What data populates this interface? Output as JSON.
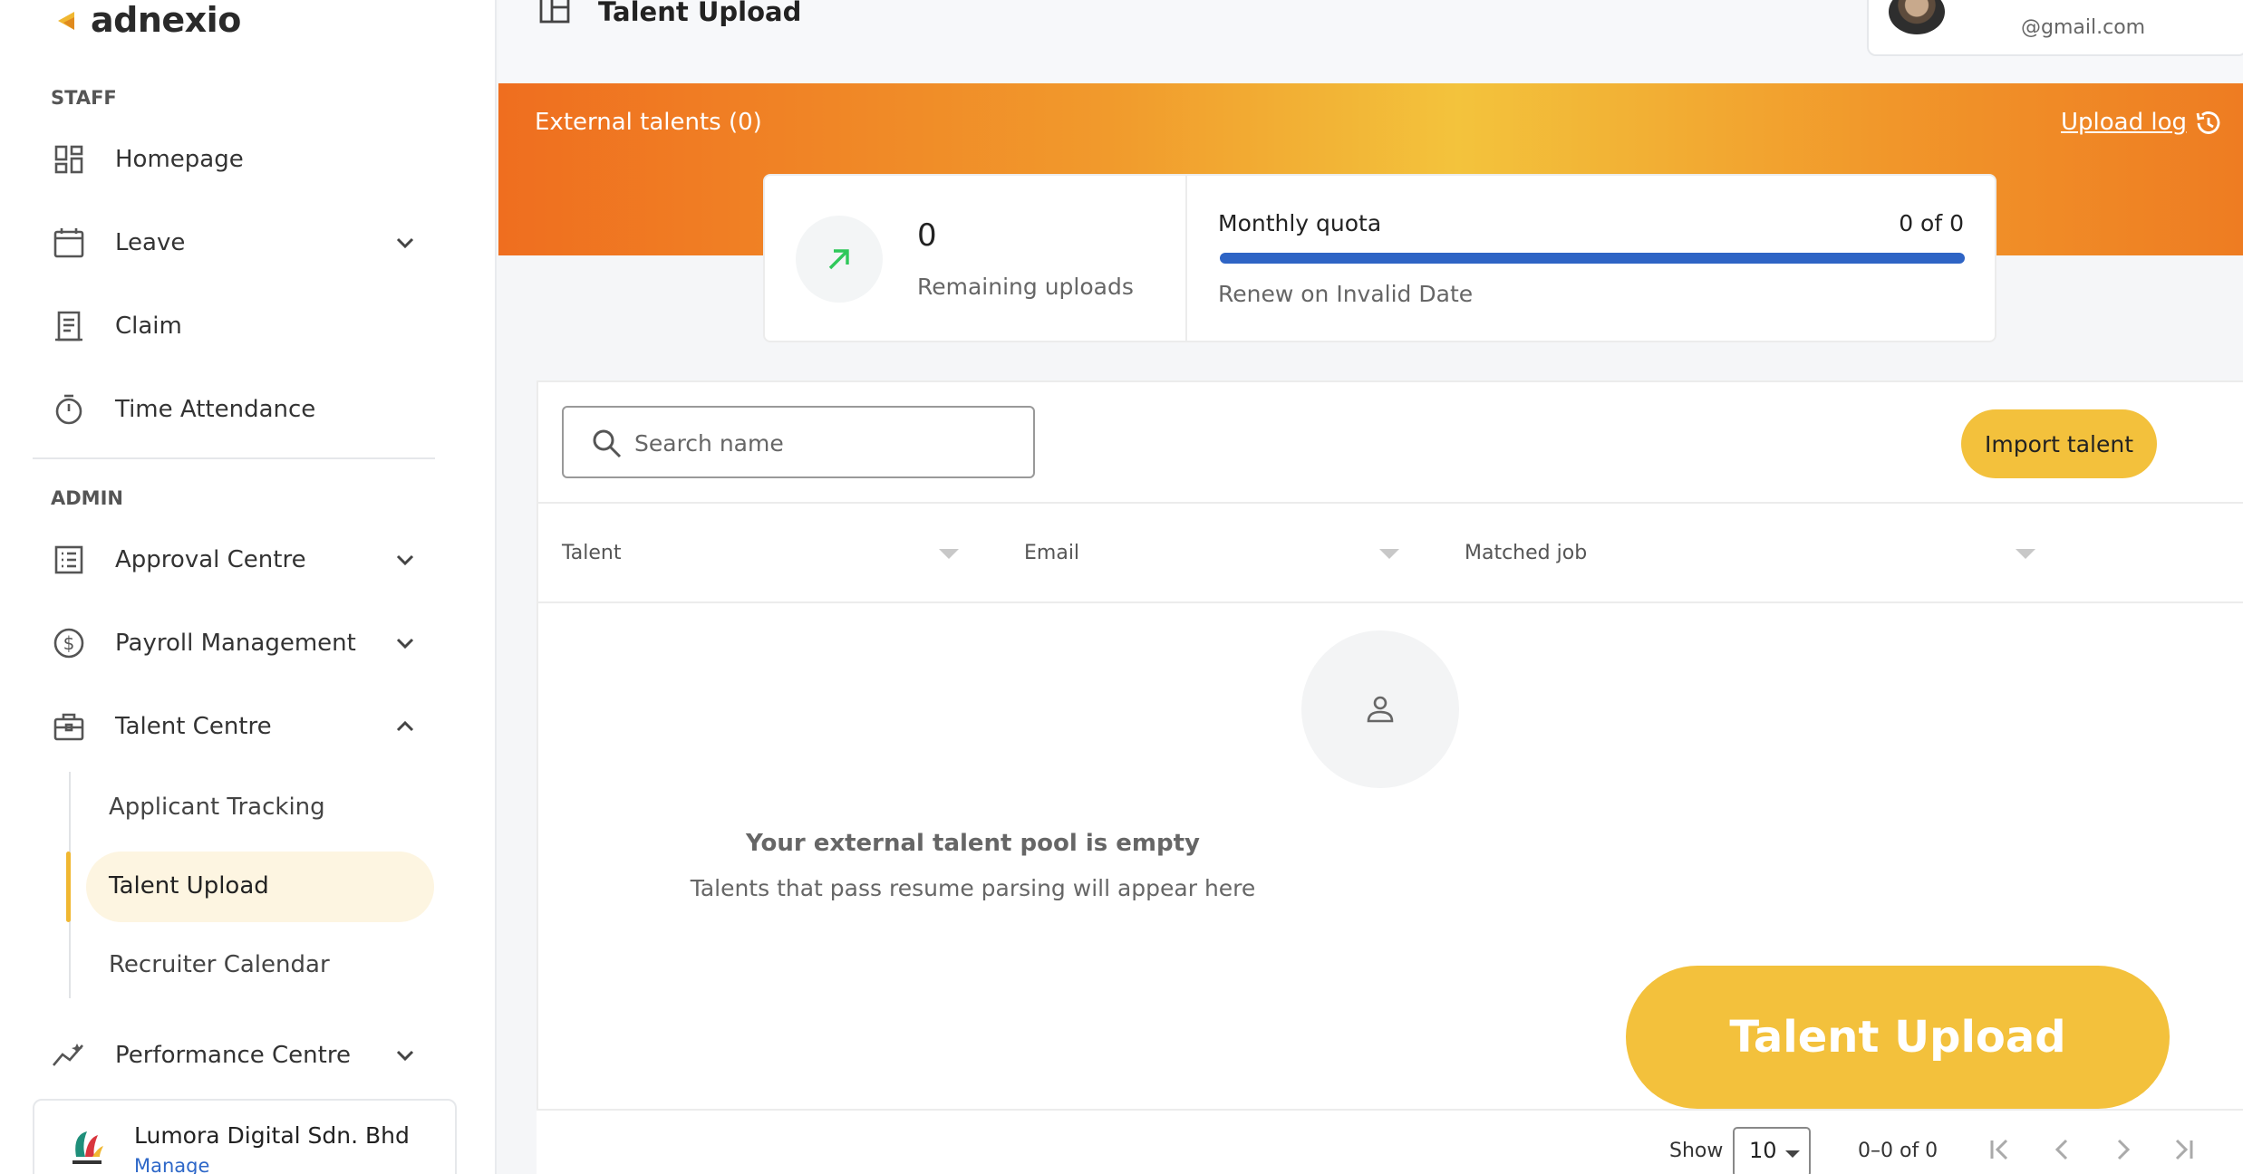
{
  "brand": {
    "name": "adnexio",
    "accent": "#f0b731"
  },
  "sidebar": {
    "staff_label": "STAFF",
    "admin_label": "ADMIN",
    "staff_items": [
      {
        "label": "Homepage",
        "icon": "dashboard-icon"
      },
      {
        "label": "Leave",
        "icon": "calendar-icon"
      },
      {
        "label": "Claim",
        "icon": "receipt-icon"
      },
      {
        "label": "Time Attendance",
        "icon": "timer-icon"
      }
    ],
    "admin_items": [
      {
        "label": "Approval Centre",
        "icon": "list-icon"
      },
      {
        "label": "Payroll Management",
        "icon": "dollar-icon"
      },
      {
        "label": "Talent Centre",
        "icon": "briefcase-icon"
      },
      {
        "label": "Performance Centre",
        "icon": "trend-icon"
      }
    ],
    "talent_sub": [
      "Applicant Tracking",
      "Talent Upload",
      "Recruiter Calendar"
    ],
    "company": {
      "name": "Lumora Digital Sdn. Bhd",
      "manage": "Manage"
    }
  },
  "header": {
    "title": "Talent Upload",
    "user_email": "@gmail.com"
  },
  "banner": {
    "title": "External talents (0)",
    "upload_log": "Upload log"
  },
  "stats": {
    "remaining_value": "0",
    "remaining_label": "Remaining uploads",
    "quota_label": "Monthly quota",
    "quota_value": "0 of 0",
    "renew": "Renew on Invalid Date"
  },
  "table": {
    "search_placeholder": "Search name",
    "import_label": "Import talent",
    "columns": [
      "Talent",
      "Email",
      "Matched job"
    ],
    "empty_title": "Your external talent pool is empty",
    "empty_sub": "Talents that pass resume parsing will appear here"
  },
  "big_button": "Talent Upload",
  "pagination": {
    "show_label": "Show",
    "page_size": "10",
    "range": "0–0 of 0"
  }
}
